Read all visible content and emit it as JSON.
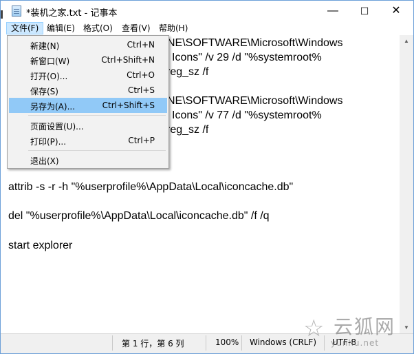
{
  "window": {
    "title": "*装机之家.txt - 记事本",
    "minimize_glyph": "—",
    "maximize_glyph": "☐",
    "close_glyph": "✕"
  },
  "menubar": {
    "items": [
      "文件(F)",
      "编辑(E)",
      "格式(O)",
      "查看(V)",
      "帮助(H)"
    ],
    "active_index": 0
  },
  "file_menu": {
    "items": [
      {
        "label": "新建(N)",
        "shortcut": "Ctrl+N"
      },
      {
        "label": "新窗口(W)",
        "shortcut": "Ctrl+Shift+N"
      },
      {
        "label": "打开(O)...",
        "shortcut": "Ctrl+O"
      },
      {
        "label": "保存(S)",
        "shortcut": "Ctrl+S"
      },
      {
        "label": "另存为(A)...",
        "shortcut": "Ctrl+Shift+S"
      },
      {
        "label": "页面设置(U)...",
        "shortcut": ""
      },
      {
        "label": "打印(P)...",
        "shortcut": "Ctrl+P"
      },
      {
        "label": "退出(X)",
        "shortcut": ""
      }
    ],
    "highlighted_index": 4
  },
  "editor": {
    "lines": [
      "NE\\SOFTWARE\\Microsoft\\Windows",
      "Icons\" /v 29 /d \"%systemroot%",
      "reg_sz /f",
      "NE\\SOFTWARE\\Microsoft\\Windows",
      "Icons\" /v 77 /d \"%systemroot%",
      "reg_sz /f",
      "attrib -s -r -h \"%userprofile%\\AppData\\Local\\iconcache.db\"",
      "del \"%userprofile%\\AppData\\Local\\iconcache.db\" /f /q",
      "start explorer"
    ]
  },
  "statusbar": {
    "position": "第 1 行，第 6 列",
    "zoom": "100%",
    "line_ending": "Windows (CRLF)",
    "encoding": "UTF-8"
  },
  "watermark": {
    "text": "云狐网",
    "url": "yunhu.net"
  },
  "colors": {
    "menu_highlight": "#91c9f7",
    "menu_active": "#cce8ff",
    "statusbar_bg": "#f0f0f0"
  }
}
